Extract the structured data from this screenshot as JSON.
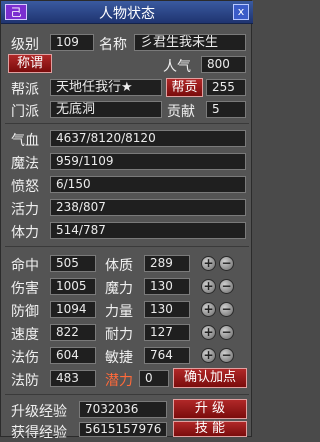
{
  "title": "人物状态",
  "title_icon": "己",
  "close_icon": "x",
  "level": {
    "label": "级别",
    "value": "109"
  },
  "name": {
    "label": "名称",
    "value": "彡君生我未生"
  },
  "title_btn": "称谓",
  "popularity": {
    "label": "人气",
    "value": "800"
  },
  "gang": {
    "label": "帮派",
    "value": "天地任我行★"
  },
  "contrib_btn": "帮贡",
  "contrib_value": "255",
  "sect": {
    "label": "门派",
    "value": "无底洞"
  },
  "devotion": {
    "label": "贡献",
    "value": "5"
  },
  "stats": [
    {
      "label": "气血",
      "value": "4637/8120/8120"
    },
    {
      "label": "魔法",
      "value": "959/1109"
    },
    {
      "label": "愤怒",
      "value": "6/150"
    },
    {
      "label": "活力",
      "value": "238/807"
    },
    {
      "label": "体力",
      "value": "514/787"
    }
  ],
  "combat": [
    {
      "label": "命中",
      "value": "505",
      "attr_label": "体质",
      "attr_value": "289"
    },
    {
      "label": "伤害",
      "value": "1005",
      "attr_label": "魔力",
      "attr_value": "130"
    },
    {
      "label": "防御",
      "value": "1094",
      "attr_label": "力量",
      "attr_value": "130"
    },
    {
      "label": "速度",
      "value": "822",
      "attr_label": "耐力",
      "attr_value": "127"
    },
    {
      "label": "法伤",
      "value": "604",
      "attr_label": "敏捷",
      "attr_value": "764"
    }
  ],
  "magic_def": {
    "label": "法防",
    "value": "483"
  },
  "potential": {
    "label": "潜力",
    "value": "0"
  },
  "confirm_btn": "确认加点",
  "upgrade_exp": {
    "label": "升级经验",
    "value": "7032036"
  },
  "upgrade_btn": "升 级",
  "gained_exp": {
    "label": "获得经验",
    "value": "5615157976"
  },
  "skill_btn": "技 能",
  "plus": "+",
  "minus": "−"
}
